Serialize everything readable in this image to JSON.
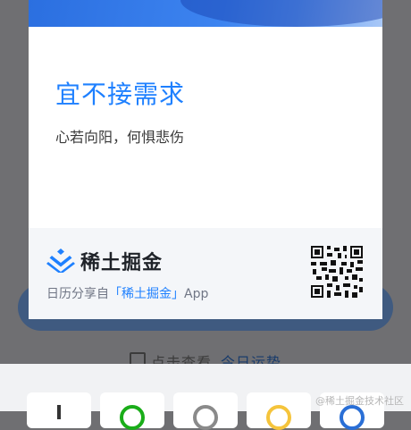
{
  "background": {
    "behind_text": "点击查看",
    "behind_link": "今日运势"
  },
  "card": {
    "title": "宜不接需求",
    "subtitle": "心若向阳，何惧悲伤",
    "footer": {
      "brand": "稀土掘金",
      "share_prefix": "日历分享自",
      "share_brand": "「稀土掘金」",
      "share_suffix": "App"
    }
  },
  "share_sheet": {
    "targets": [
      {
        "icon": "plus-icon",
        "color": "#333333"
      },
      {
        "icon": "wechat-icon",
        "color": "#1aad19"
      },
      {
        "icon": "moments-icon",
        "color": "#8a8a8a"
      },
      {
        "icon": "qzone-icon",
        "color": "#f5c43b"
      },
      {
        "icon": "weibo-icon",
        "color": "#2a6fd6"
      }
    ]
  },
  "watermark": "@稀土掘金技术社区",
  "colors": {
    "accent": "#1e80ff",
    "overlay": "#6f6f72"
  }
}
